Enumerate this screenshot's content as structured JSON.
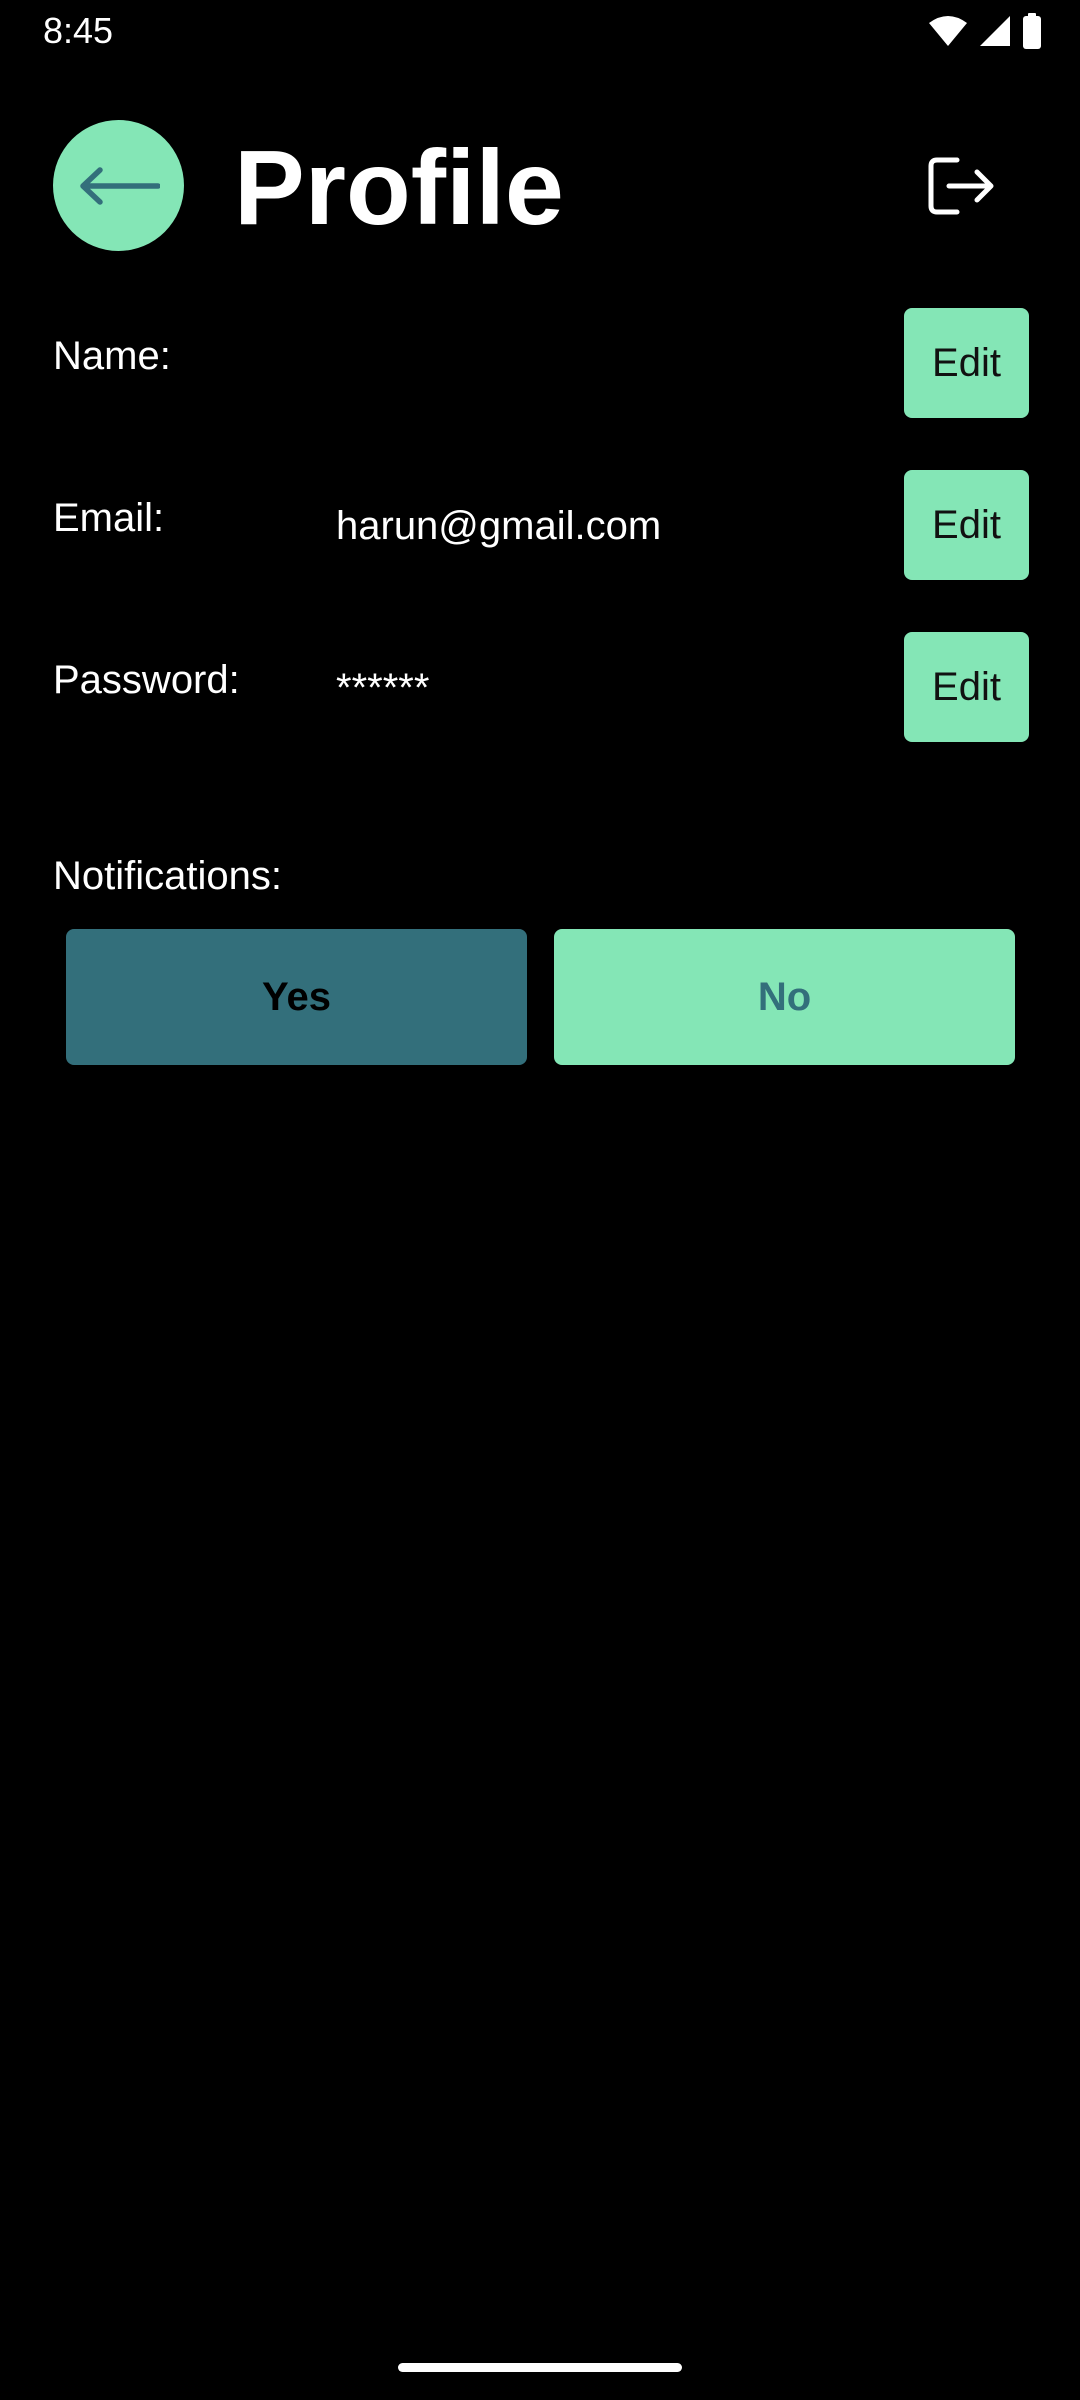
{
  "status_bar": {
    "time": "8:45",
    "icons": [
      "wifi-icon",
      "cell-signal-icon",
      "battery-icon"
    ]
  },
  "header": {
    "back_icon": "arrow-left-icon",
    "title": "Profile",
    "logout_icon": "logout-icon"
  },
  "fields": {
    "name": {
      "label": "Name:",
      "value": "",
      "edit_label": "Edit"
    },
    "email": {
      "label": "Email:",
      "value": "harun@gmail.com",
      "edit_label": "Edit"
    },
    "password": {
      "label": "Password:",
      "value": "******",
      "edit_label": "Edit"
    }
  },
  "notifications": {
    "label": "Notifications:",
    "yes_label": "Yes",
    "no_label": "No",
    "selected": "Yes"
  },
  "colors": {
    "background": "#000000",
    "accent": "#84e6b6",
    "selected": "#336f7b",
    "text": "#ffffff"
  }
}
